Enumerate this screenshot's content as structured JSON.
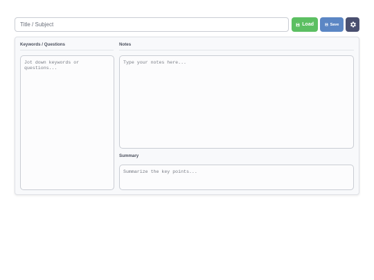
{
  "header": {
    "title_placeholder": "Title / Subject",
    "load_label": "Load",
    "save_label": "Save",
    "load_icon": "floppy-icon",
    "save_icon": "floppy-icon",
    "settings_icon": "gear-icon"
  },
  "notes_card": {
    "keywords_heading": "Keywords / Questions",
    "keywords_placeholder": "Jot down keywords or questions...",
    "notes_heading": "Notes",
    "notes_placeholder": "Type your notes here...",
    "summary_heading": "Summary",
    "summary_placeholder": "Summarize the key points..."
  },
  "colors": {
    "load_button": "#5cbf62",
    "save_button": "#5b86c4",
    "settings_button": "#4a5070"
  }
}
